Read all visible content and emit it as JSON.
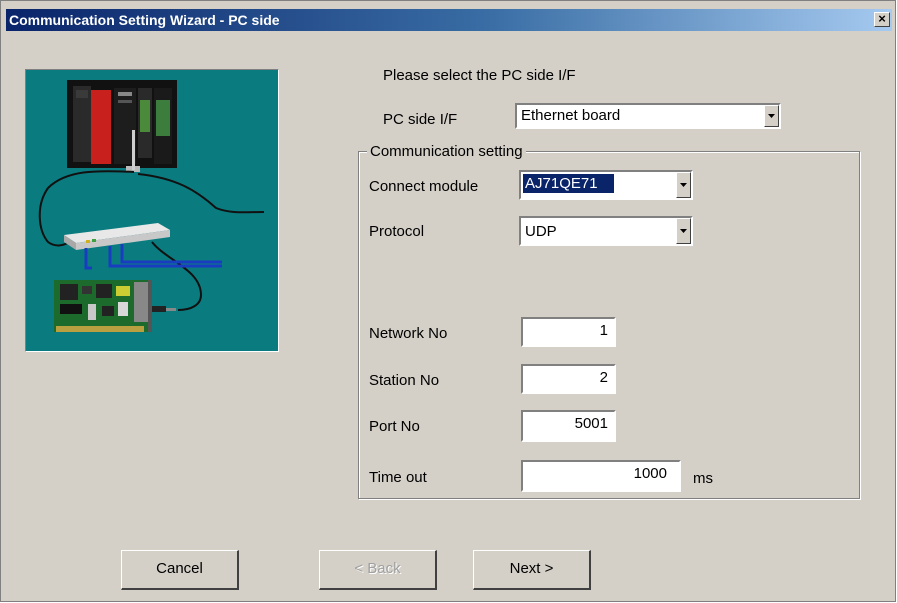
{
  "window": {
    "title": "Communication Setting Wizard - PC side",
    "close_glyph": "×"
  },
  "prompt": "Please select the PC side I/F",
  "pc_side_if": {
    "label": "PC side I/F",
    "value": "Ethernet board"
  },
  "communication": {
    "group_label": "Communication setting",
    "connect_module": {
      "label": "Connect module",
      "value": "AJ71QE71"
    },
    "protocol": {
      "label": "Protocol",
      "value": "UDP"
    },
    "network_no": {
      "label": "Network No",
      "value": "1"
    },
    "station_no": {
      "label": "Station No",
      "value": "2"
    },
    "port_no": {
      "label": "Port No",
      "value": "5001"
    },
    "time_out": {
      "label": "Time out",
      "value": "1000",
      "unit": "ms"
    }
  },
  "buttons": {
    "cancel": "Cancel",
    "back": "< Back",
    "next": "Next >"
  },
  "illustration": {
    "icons": [
      "plc-rack-icon",
      "ethernet-hub-icon",
      "ethernet-board-icon"
    ]
  },
  "colors": {
    "title_start": "#0a246a",
    "title_end": "#a6caf0",
    "dialog_bg": "#d4d0c8",
    "illustration_bg": "#0a7c80",
    "selection": "#0a246a"
  }
}
